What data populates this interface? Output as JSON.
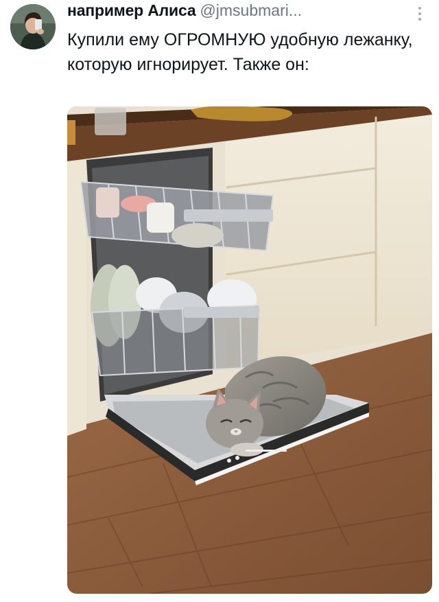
{
  "tweet": {
    "display_name": "например Алиса",
    "handle": "@jmsubmari...",
    "text": "Купили ему ОГРОМНУЮ удобную лежанку, которую игнорирует. Также он:",
    "avatar_icon": "user-avatar",
    "more_icon": "more-vertical-icon"
  },
  "media": {
    "subject": "photo",
    "colors": {
      "floor": "#8b5b3c",
      "cabinet": "#efe7d6",
      "counter": "#6b4226",
      "cat": "#8e8a83"
    }
  }
}
